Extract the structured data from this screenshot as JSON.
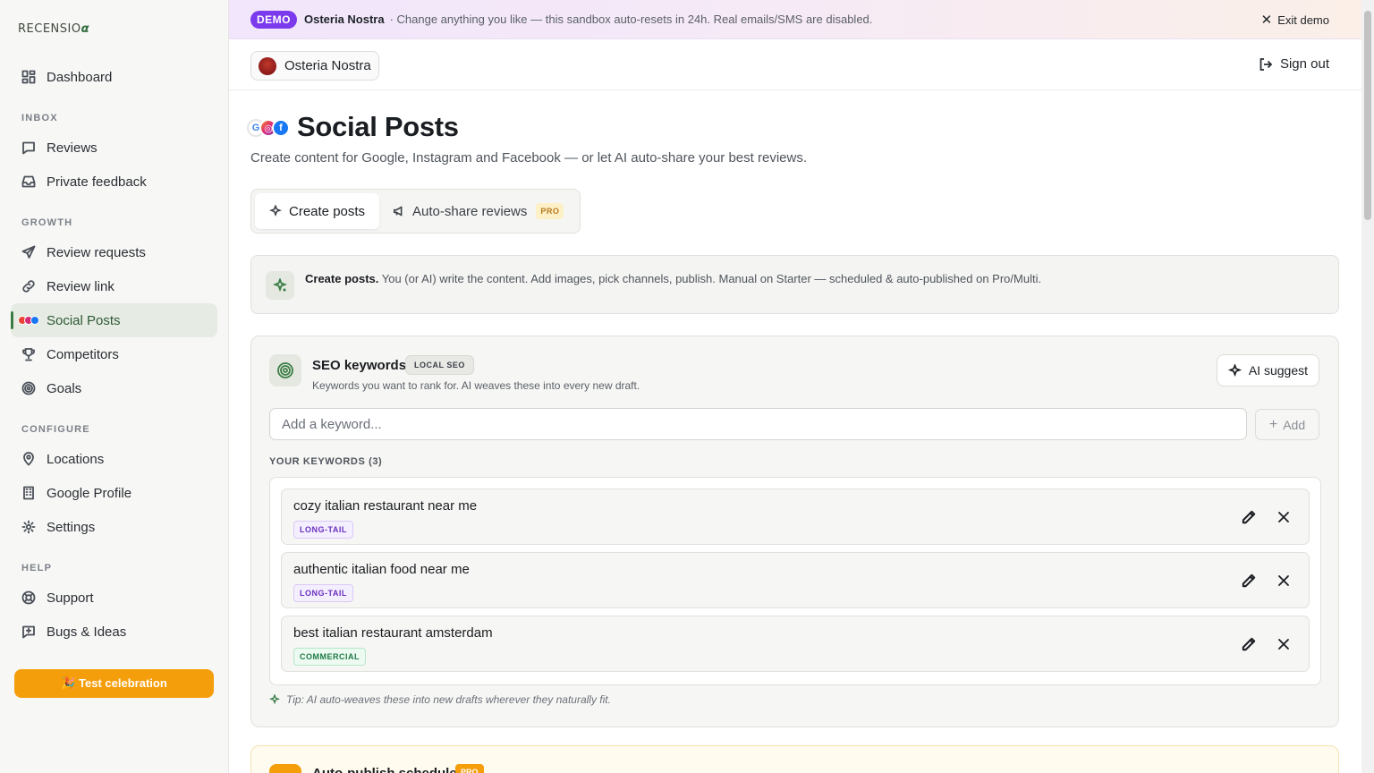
{
  "brand": {
    "logo_text": "RECENSIO",
    "logo_mark": "α"
  },
  "sidebar": {
    "dashboard": "Dashboard",
    "sections": {
      "inbox": "INBOX",
      "growth": "GROWTH",
      "configure": "CONFIGURE",
      "help": "HELP"
    },
    "items": {
      "reviews": "Reviews",
      "private_feedback": "Private feedback",
      "review_requests": "Review requests",
      "review_link": "Review link",
      "social_posts": "Social Posts",
      "competitors": "Competitors",
      "goals": "Goals",
      "locations": "Locations",
      "google_profile": "Google Profile",
      "settings": "Settings",
      "support": "Support",
      "bugs_ideas": "Bugs & Ideas"
    },
    "celebration_button": "🎉 Test celebration"
  },
  "banner": {
    "badge": "DEMO",
    "venue": "Osteria Nostra",
    "message": "· Change anything you like — this sandbox auto-resets in 24h. Real emails/SMS are disabled.",
    "exit": "Exit demo"
  },
  "topbar": {
    "location": "Osteria Nostra",
    "sign_out": "Sign out"
  },
  "page": {
    "title": "Social Posts",
    "subtitle": "Create content for Google, Instagram and Facebook — or let AI auto-share your best reviews."
  },
  "tabs": {
    "create": "Create posts",
    "autoshare": "Auto-share reviews",
    "pro": "PRO"
  },
  "info": {
    "lead": "Create posts.",
    "text": " You (or AI) write the content. Add images, pick channels, publish. Manual on Starter — scheduled & auto-published on Pro/Multi."
  },
  "seo": {
    "title": "SEO keywords",
    "badge": "LOCAL SEO",
    "subtitle": "Keywords you want to rank for. AI weaves these into every new draft.",
    "ai_suggest": "AI suggest",
    "input_placeholder": "Add a keyword...",
    "add": "Add",
    "list_heading": "YOUR KEYWORDS (3)",
    "keywords": [
      {
        "text": "cozy italian restaurant near me",
        "tag": "LONG-TAIL"
      },
      {
        "text": "authentic italian food near me",
        "tag": "LONG-TAIL"
      },
      {
        "text": "best italian restaurant amsterdam",
        "tag": "COMMERCIAL"
      }
    ],
    "tip": "Tip: AI auto-weaves these into new drafts wherever they naturally fit."
  },
  "schedule": {
    "title": "Auto-publish schedule",
    "badge": "PRO"
  },
  "colors": {
    "accent": "#3a7d44",
    "demo_badge": "#7c3aed",
    "celebration": "#f59e0b",
    "pro_badge": "#b7791f"
  }
}
